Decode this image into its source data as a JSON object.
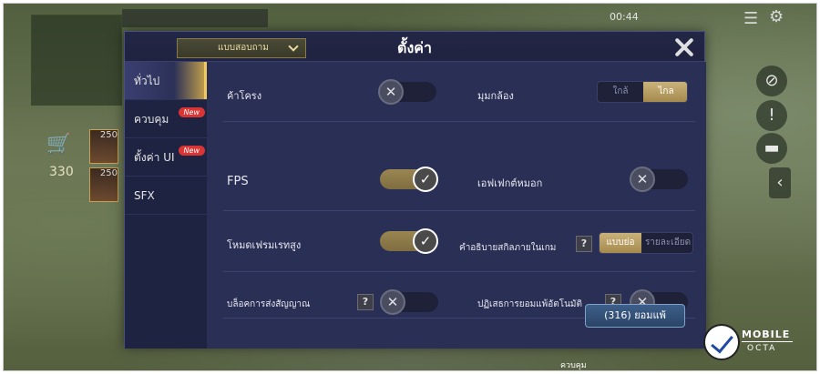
{
  "hud": {
    "time": "00:44",
    "gold": "330",
    "item_costs": [
      "250",
      "250"
    ],
    "bottom_label": "ควบคุม"
  },
  "dialog": {
    "title": "ตั้งค่า",
    "mode_dropdown": "แบบสอบถาม",
    "sidebar": [
      {
        "label": "ทั่วไป",
        "active": true,
        "badge": ""
      },
      {
        "label": "ควบคุม",
        "active": false,
        "badge": "New"
      },
      {
        "label": "ตั้งค่า UI",
        "active": false,
        "badge": "New"
      },
      {
        "label": "SFX",
        "active": false,
        "badge": ""
      }
    ],
    "settings": {
      "outline_label": "ค้าโครง",
      "outline_on": false,
      "camera_label": "มุมกล้อง",
      "camera_options": [
        "ใกล้",
        "ไกล"
      ],
      "camera_selected": "ไกล",
      "fps_label": "FPS",
      "fps_on": true,
      "fog_label": "เอฟเฟกต์หมอก",
      "fog_on": false,
      "high_frame_label": "โหมดเฟรมเรทสูง",
      "high_frame_on": true,
      "skill_desc_label": "คำอธิบายสกิลภายในเกม",
      "skill_desc_options": [
        "แบบย่อ",
        "รายละเอียด"
      ],
      "skill_desc_selected": "แบบย่อ",
      "block_signal_label": "บล็อคการส่งสัญญาณ",
      "block_signal_on": false,
      "auto_reject_label": "ปฏิเสธการยอมแพ้อัตโนมัติ",
      "auto_reject_on": false,
      "help_glyph": "?"
    },
    "surrender_button": "(316) ยอมแพ้"
  },
  "watermark": {
    "line1": "MOBILE",
    "line2": "OCTA"
  }
}
